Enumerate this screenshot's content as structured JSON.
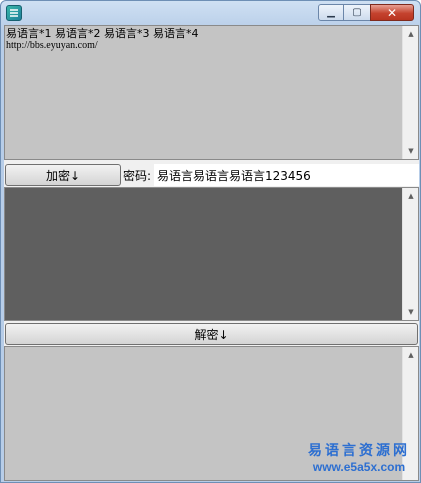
{
  "window": {
    "controls": {
      "minimize": "▁",
      "maximize": "▢",
      "close": "✕"
    }
  },
  "plaintext": {
    "lines": [
      "易语言*1 易语言*2 易语言*3 易语言*4",
      "http://bbs.eyuyan.com/"
    ]
  },
  "encrypt_button": {
    "label": "加密↓"
  },
  "password": {
    "label": "密码:",
    "value": "易语言易语言易语言123456"
  },
  "decrypt_button": {
    "label": "解密↓"
  },
  "scrollbar": {
    "up": "▲",
    "down": "▼"
  },
  "watermark": {
    "cn": "易语言资源网",
    "url": "www.e5a5x.com"
  },
  "colors": {
    "textbox_bg": "#c4c4c4",
    "ciphertext_bg": "#5f5f5f",
    "titlebar": "#b7cde8",
    "watermark": "#2d6fd1"
  },
  "icons": [
    "app-icon",
    "minimize-icon",
    "maximize-icon",
    "close-icon",
    "scroll-up-icon",
    "scroll-down-icon"
  ]
}
